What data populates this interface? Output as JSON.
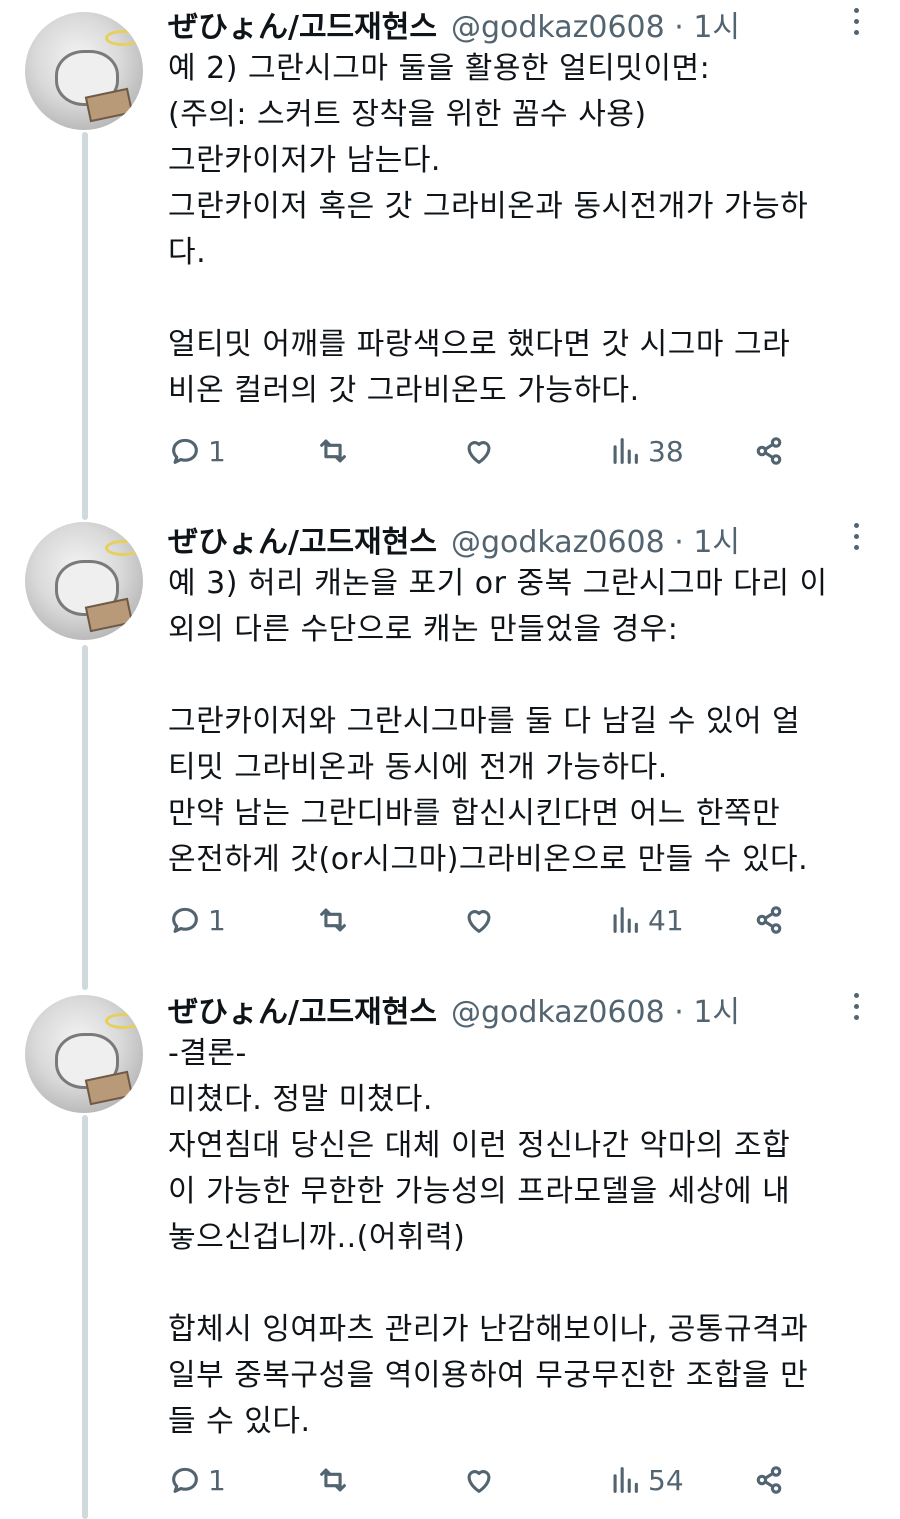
{
  "tweets": [
    {
      "name": "ぜひょん/고드재현스",
      "handle": "@godkaz0608 · 1시",
      "lines": [
        "예 2) 그란시그마 둘을 활용한 얼티밋이면:",
        "(주의: 스커트 장착을 위한 꼼수 사용)",
        "그란카이저가 남는다.",
        "그란카이저 혹은 갓 그라비온과 동시전개가 가능하",
        "다.",
        "",
        "얼티밋 어깨를 파랑색으로 했다면 갓 시그마 그라",
        "비온 컬러의 갓 그라비온도 가능하다."
      ],
      "replies": "1",
      "views": "38"
    },
    {
      "name": "ぜひょん/고드재현스",
      "handle": "@godkaz0608 · 1시",
      "lines": [
        "예 3) 허리 캐논을 포기 or 중복 그란시그마 다리 이",
        "외의 다른 수단으로 캐논 만들었을 경우:",
        "",
        "그란카이저와 그란시그마를 둘 다 남길 수 있어 얼",
        "티밋 그라비온과 동시에 전개 가능하다.",
        "만약 남는 그란디바를 합신시킨다면 어느 한쪽만",
        "온전하게 갓(or시그마)그라비온으로 만들 수 있다."
      ],
      "replies": "1",
      "views": "41"
    },
    {
      "name": "ぜひょん/고드재현스",
      "handle": "@godkaz0608 · 1시",
      "lines": [
        "-결론-",
        "미쳤다. 정말 미쳤다.",
        "자연침대 당신은 대체 이런 정신나간 악마의 조합",
        "이 가능한 무한한 가능성의 프라모델을 세상에 내",
        "놓으신겁니까..(어휘력)",
        "",
        "합체시 잉여파츠 관리가 난감해보이나, 공통규격과",
        "일부 중복구성을 역이용하여 무궁무진한 조합을 만",
        "들 수 있다."
      ],
      "replies": "1",
      "views": "54"
    }
  ],
  "icons": {
    "reply": "reply-icon",
    "retweet": "retweet-icon",
    "like": "like-icon",
    "views": "views-icon",
    "share": "share-icon",
    "more": "more-icon"
  },
  "colors": {
    "text": "#0f1419",
    "secondary": "#536471",
    "thread_line": "#cfd9de"
  }
}
